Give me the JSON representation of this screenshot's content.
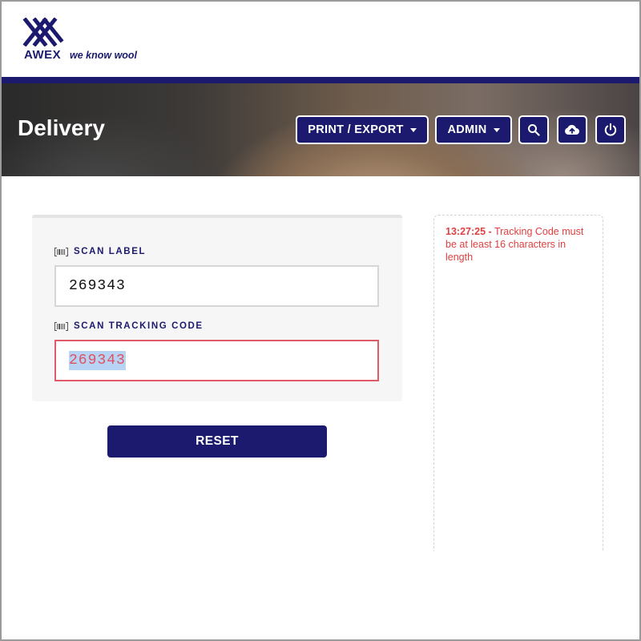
{
  "brand": {
    "name": "AWEX",
    "tagline": "we know wool",
    "color": "#1b1a6e"
  },
  "header": {
    "title": "Delivery",
    "buttons": {
      "print_export": "PRINT / EXPORT",
      "admin": "ADMIN",
      "search_icon": "search-icon",
      "upload_icon": "cloud-upload-icon",
      "power_icon": "power-icon"
    }
  },
  "form": {
    "scan_label": {
      "label": "SCAN LABEL",
      "value": "269343"
    },
    "scan_tracking_code": {
      "label": "SCAN TRACKING CODE",
      "value": "269343",
      "state": "error"
    },
    "reset_label": "RESET"
  },
  "log": {
    "messages": [
      {
        "time": "13:27:25 -",
        "text": "Tracking Code must be at least 16 characters in length",
        "level": "error"
      }
    ]
  },
  "colors": {
    "primary": "#1b1a6e",
    "error": "#e04040",
    "selection": "#b8d4f4"
  }
}
